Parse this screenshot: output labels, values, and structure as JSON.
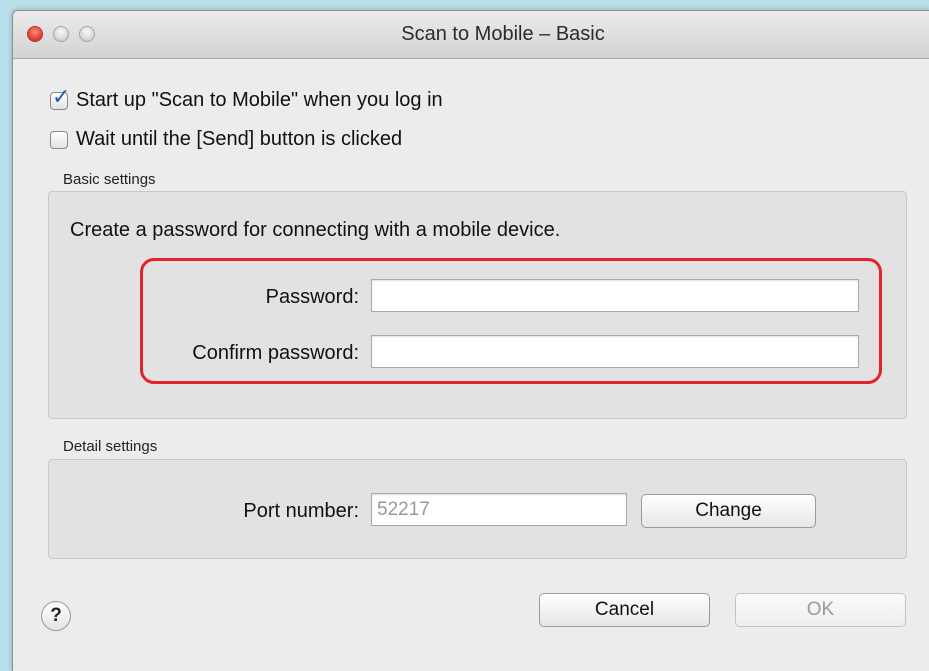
{
  "window": {
    "title": "Scan to Mobile – Basic"
  },
  "options": {
    "startup_label": "Start up \"Scan to Mobile\" when you log in",
    "startup_checked": true,
    "wait_label": "Wait until the [Send] button is clicked",
    "wait_checked": false
  },
  "basic_settings": {
    "heading": "Basic settings",
    "instruction": "Create a password for connecting with a mobile device.",
    "password_label": "Password:",
    "password_value": "",
    "confirm_label": "Confirm password:",
    "confirm_value": ""
  },
  "detail_settings": {
    "heading": "Detail settings",
    "port_label": "Port number:",
    "port_value": "52217",
    "change_label": "Change"
  },
  "footer": {
    "help_glyph": "?",
    "cancel_label": "Cancel",
    "ok_label": "OK",
    "ok_enabled": false
  },
  "colors": {
    "highlight": "#e3232b",
    "checkmark": "#1f5fb3",
    "background": "#b9e0ea"
  }
}
